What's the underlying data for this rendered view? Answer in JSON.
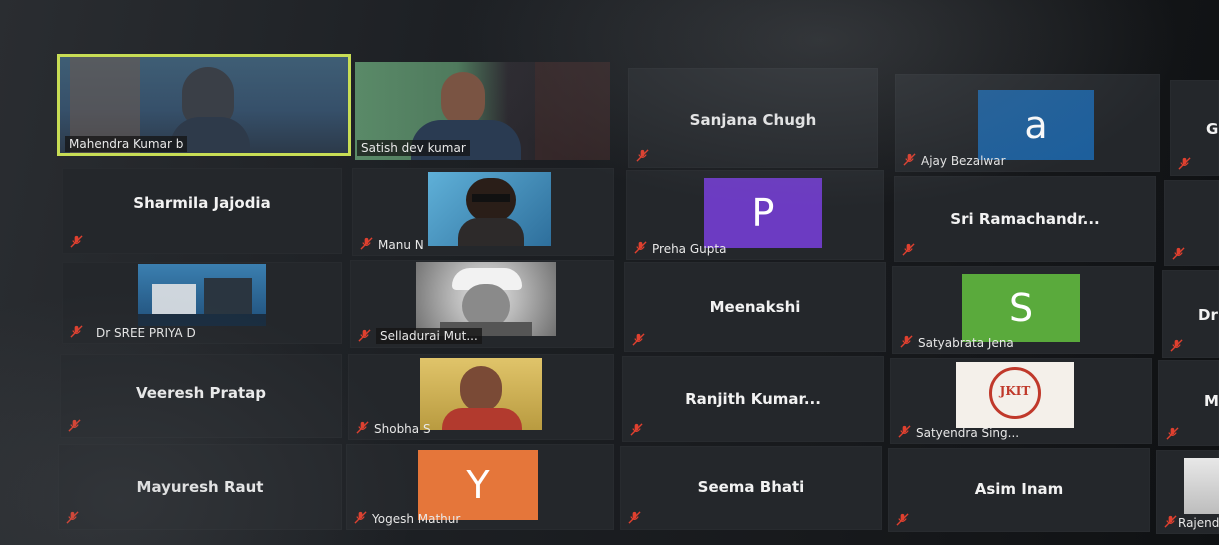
{
  "participants": [
    {
      "name": "Mahendra Kumar b"
    },
    {
      "name": "Satish dev kumar"
    },
    {
      "name": "Sanjana Chugh"
    },
    {
      "name": "Ajay Bezalwar",
      "avatar_letter": "a",
      "avatar_color": "#1d5f9c"
    },
    {
      "name": "G"
    },
    {
      "name": "Sharmila Jajodia"
    },
    {
      "name": "Manu N"
    },
    {
      "name": "Preha Gupta",
      "avatar_letter": "P",
      "avatar_color": "#6c3bc2"
    },
    {
      "name": "Sri  Ramachandr..."
    },
    {
      "name": "Dr SREE PRIYA D"
    },
    {
      "name": "Selladurai Mut..."
    },
    {
      "name": "Meenakshi"
    },
    {
      "name": "Satyabrata Jena",
      "avatar_letter": "S",
      "avatar_color": "#5aaa3c"
    },
    {
      "name": "Dr"
    },
    {
      "name": "Veeresh Pratap"
    },
    {
      "name": "Shobha S"
    },
    {
      "name": "Ranjith  Kumar..."
    },
    {
      "name": "Satyendra Sing..."
    },
    {
      "name": "M"
    },
    {
      "name": "Mayuresh Raut"
    },
    {
      "name": "Yogesh Mathur",
      "avatar_letter": "Y",
      "avatar_color": "#e5763a"
    },
    {
      "name": "Seema Bhati"
    },
    {
      "name": "Asim Inam"
    },
    {
      "name": "Rajend"
    }
  ],
  "jkit_logo_text": "JKIT",
  "colors": {
    "active_speaker_border": "#c8dd55",
    "muted_icon": "#e0402f",
    "tile_bg": "#24272b"
  },
  "icons": {
    "muted": "mic-muted-icon"
  }
}
